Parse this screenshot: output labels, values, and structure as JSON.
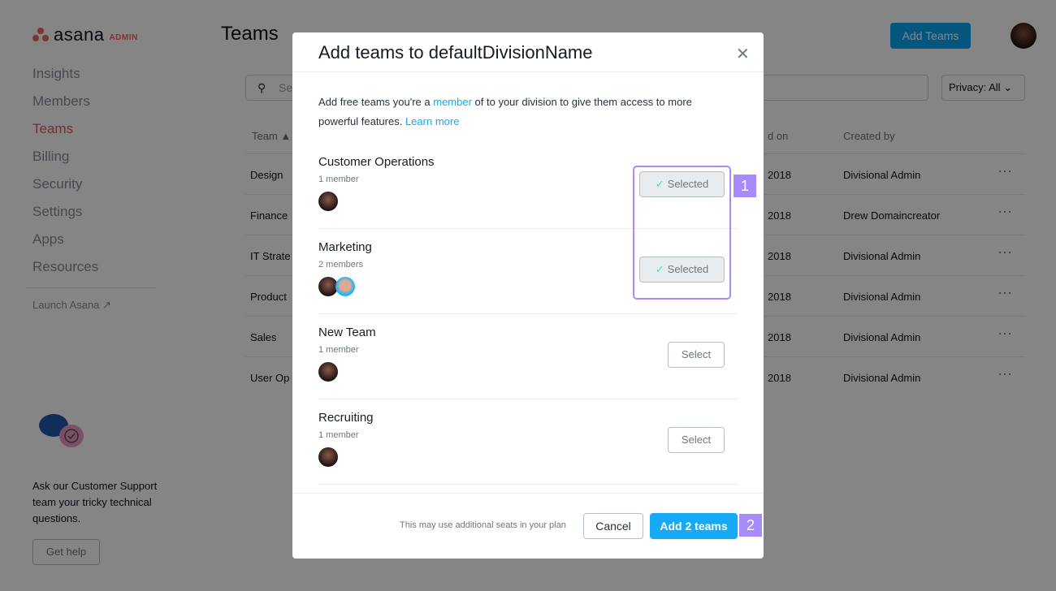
{
  "sidebar": {
    "logo": "asana",
    "logo_badge": "ADMIN",
    "items": [
      {
        "label": "Insights"
      },
      {
        "label": "Members"
      },
      {
        "label": "Teams",
        "active": true
      },
      {
        "label": "Billing"
      },
      {
        "label": "Security"
      },
      {
        "label": "Settings"
      },
      {
        "label": "Apps"
      },
      {
        "label": "Resources"
      }
    ],
    "launch": "Launch Asana",
    "support_text": "Ask our Customer Support team your tricky technical questions.",
    "get_help": "Get help"
  },
  "header": {
    "title": "Teams",
    "add_button": "Add Teams"
  },
  "filters": {
    "search_placeholder": "Se",
    "privacy": "Privacy: All"
  },
  "table": {
    "headers": {
      "team": "Team",
      "created_on": "d on",
      "created_by": "Created by"
    },
    "rows": [
      {
        "team": "Design",
        "date": "2018",
        "by": "Divisional Admin"
      },
      {
        "team": "Finance",
        "date": "2018",
        "by": "Drew Domaincreator"
      },
      {
        "team": "IT Strate",
        "date": "2018",
        "by": "Divisional Admin"
      },
      {
        "team": "Product",
        "date": "2018",
        "by": "Divisional Admin"
      },
      {
        "team": "Sales",
        "date": "2018",
        "by": "Divisional Admin"
      },
      {
        "team": "User Op",
        "date": "2018",
        "by": "Divisional Admin"
      }
    ]
  },
  "modal": {
    "title": "Add teams to defaultDivisionName",
    "desc_pre": "Add free teams you're a ",
    "desc_link": "member",
    "desc_post": " of to your division to give them access to more powerful features. ",
    "learn_more": "Learn more",
    "teams": [
      {
        "name": "Customer Operations",
        "count": "1 member",
        "button": "Selected",
        "selected": true
      },
      {
        "name": "Marketing",
        "count": "2 members",
        "button": "Selected",
        "selected": true
      },
      {
        "name": "New Team",
        "count": "1 member",
        "button": "Select",
        "selected": false
      },
      {
        "name": "Recruiting",
        "count": "1 member",
        "button": "Select",
        "selected": false
      }
    ],
    "note": "This may use additional seats in your plan",
    "cancel": "Cancel",
    "confirm": "Add 2 teams"
  },
  "annotations": [
    "1",
    "2"
  ],
  "colors": {
    "accent": "#14aaf5",
    "brand": "#e8384f",
    "annotation": "#a78bfa"
  }
}
